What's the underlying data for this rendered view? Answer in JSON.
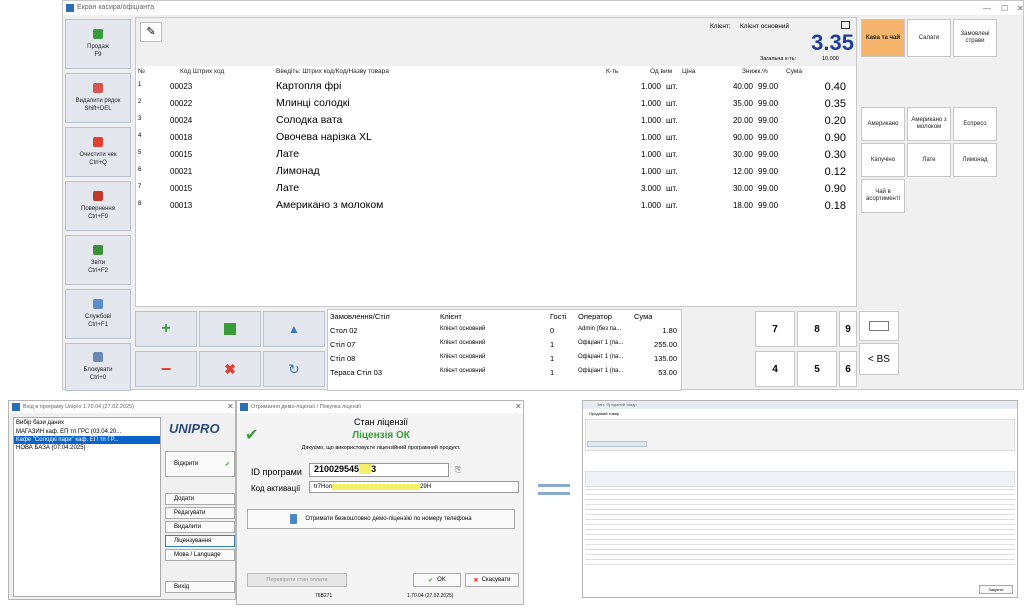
{
  "main": {
    "title": "Екран касира/офіціанта",
    "client_label": "Клієнт:",
    "client_value": "Клієнт основний",
    "total": "3.35",
    "total_qty_label": "Загальна к-ть:",
    "total_qty": "10.000",
    "columns": {
      "no": "№",
      "code": "Код Штрих код",
      "input": "Введіть: Штрих код/Код/Назву товара",
      "qty": "К-ть",
      "unit": "Од вим",
      "price": "Ціна",
      "disc": "Знижк.%",
      "sum": "Сума"
    },
    "rows": [
      {
        "n": "1",
        "code": "00023",
        "name": "Картопля фрі",
        "qty": "1.000",
        "unit": "шт.",
        "price": "40.00",
        "disc": "99.00",
        "sum": "0.40"
      },
      {
        "n": "2",
        "code": "00022",
        "name": "Млинці солодкі",
        "qty": "1.000",
        "unit": "шт.",
        "price": "35.00",
        "disc": "99.00",
        "sum": "0.35"
      },
      {
        "n": "3",
        "code": "00024",
        "name": "Солодка вата",
        "qty": "1.000",
        "unit": "шт.",
        "price": "20.00",
        "disc": "99.00",
        "sum": "0.20"
      },
      {
        "n": "4",
        "code": "00018",
        "name": "Овочева нарізка XL",
        "qty": "1.000",
        "unit": "шт.",
        "price": "90.00",
        "disc": "99.00",
        "sum": "0.90"
      },
      {
        "n": "5",
        "code": "00015",
        "name": "Лате",
        "qty": "1.000",
        "unit": "шт.",
        "price": "30.00",
        "disc": "99.00",
        "sum": "0.30"
      },
      {
        "n": "6",
        "code": "00021",
        "name": "Лимонад",
        "qty": "1.000",
        "unit": "шт.",
        "price": "12.00",
        "disc": "99.00",
        "sum": "0.12"
      },
      {
        "n": "7",
        "code": "00015",
        "name": "Лате",
        "qty": "3.000",
        "unit": "шт.",
        "price": "30.00",
        "disc": "99.00",
        "sum": "0.90"
      },
      {
        "n": "8",
        "code": "00013",
        "name": "Американо з молоком",
        "qty": "1.000",
        "unit": "шт.",
        "price": "18.00",
        "disc": "99.00",
        "sum": "0.18"
      }
    ],
    "left_buttons": [
      {
        "label": "Продаж\nF9"
      },
      {
        "label": "Видалити рядок\nShift+DEL"
      },
      {
        "label": "Очистити чек\nCtrl+Q"
      },
      {
        "label": "Повернення\nCtrl+F9"
      },
      {
        "label": "Звіти\nCtrl+F2"
      },
      {
        "label": "Службові\nCtrl+F1"
      },
      {
        "label": "Блокувати\nCtrl+0"
      }
    ],
    "categories": [
      "Кава та чай",
      "Салати",
      "Замовлені страви"
    ],
    "products": [
      "Американо",
      "Американо з молоком",
      "Еспресо",
      "Капучіно",
      "Лате",
      "Лимонад",
      "Чай в асортименті"
    ],
    "orders": {
      "headers": [
        "Замовлення/Стіл",
        "Клієнт",
        "Гості",
        "Оператор",
        "Сума"
      ],
      "rows": [
        [
          "Стол 02",
          "Клієнт основний",
          "0",
          "Admin (без па...",
          "1.80"
        ],
        [
          "Стіл 07",
          "Клієнт основний",
          "1",
          "Офіціант 1 (па...",
          "255.00"
        ],
        [
          "Стіл 08",
          "Клієнт основний",
          "1",
          "Офіціант 1 (па...",
          "135.00"
        ],
        [
          "Тераса Стіл 03",
          "Клієнт основний",
          "1",
          "Офіціант 1 (па...",
          "53.00"
        ]
      ]
    },
    "keypad": [
      "7",
      "8",
      "9",
      "4",
      "5",
      "6"
    ],
    "backspace_label": "< BS"
  },
  "login": {
    "title": "Вхід в програму Unipro 1.70.04 (27.02.2025)",
    "db_label": "Вибір бази даних",
    "databases": [
      "МАГАЗИН каф. ЕП тп ГРС (03.04.20...",
      "Кафе \"Солодкі пари\" каф. ЕП тп ГР...",
      "НОВА БАЗА (07.04.2025)"
    ],
    "logo": "UNIPRO",
    "open_label": "Відкрити",
    "buttons": [
      "Додати",
      "Редагувати",
      "Видалити",
      "Ліцензування",
      "Мова / Language",
      "Вихід"
    ]
  },
  "license": {
    "title": "Отримання демо-ліцензії / Покупка ліцензії",
    "state_title": "Стан ліцензії",
    "state": "Ліцензія ОК",
    "thanks": "Дякуємо, що використовуєте ліцензійний програмний продукт.",
    "program_id_label": "ID програми",
    "program_id": "210029545",
    "program_id_tail": "3",
    "activation_label": "Код активації",
    "activation_code": "tr7Hon",
    "activation_tail": "29H",
    "demo_button": "Отримати безкоштовно демо-ліцензію по номеру телефона",
    "check_button": "Перевірити стан оплати",
    "ok_label": "OK",
    "cancel_label": "Скасувати",
    "footer_left": "76B271",
    "footer_right": "1.70.04 (27.02.2025)"
  },
  "report": {
    "title": "Звіт: Проданий товар",
    "tab": "Проданий товар",
    "close_label": "Закрити"
  }
}
